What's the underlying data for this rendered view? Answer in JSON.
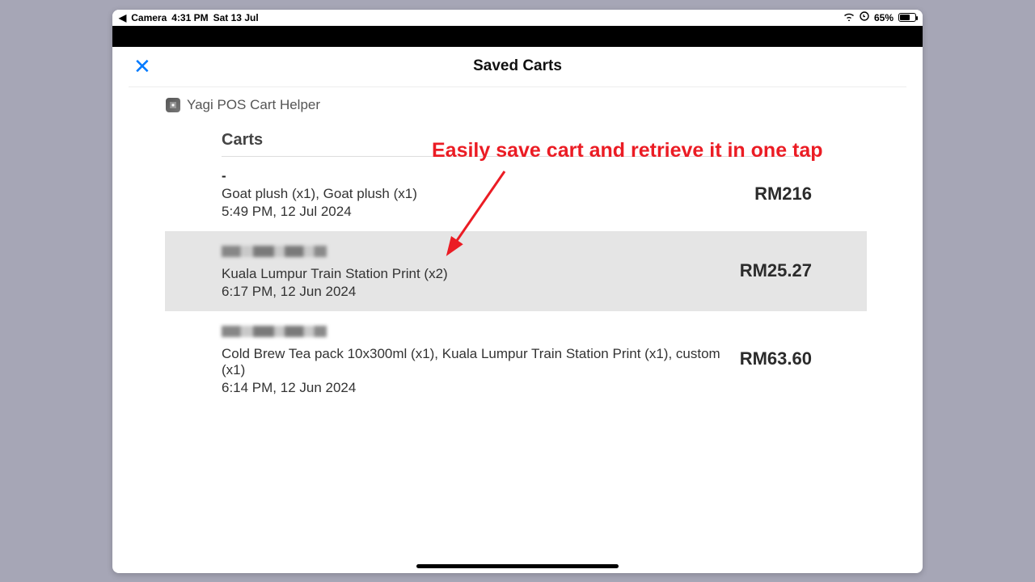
{
  "status": {
    "back_label": "Camera",
    "time": "4:31 PM",
    "date": "Sat 13 Jul",
    "battery_pct": "65%"
  },
  "modal": {
    "title": "Saved Carts",
    "app_name": "Yagi POS Cart Helper",
    "section_heading": "Carts"
  },
  "annotation": {
    "text": "Easily save cart and retrieve it in one tap"
  },
  "carts": [
    {
      "title": "-",
      "description": "Goat plush (x1), Goat plush (x1)",
      "timestamp": "5:49 PM, 12 Jul 2024",
      "price": "RM216",
      "redacted_title": false,
      "highlighted": false
    },
    {
      "title": "",
      "description": "Kuala Lumpur Train Station Print (x2)",
      "timestamp": "6:17 PM, 12 Jun 2024",
      "price": "RM25.27",
      "redacted_title": true,
      "highlighted": true
    },
    {
      "title": "",
      "description": "Cold Brew Tea pack 10x300ml (x1), Kuala Lumpur Train Station Print (x1), custom (x1)",
      "timestamp": "6:14 PM, 12 Jun 2024",
      "price": "RM63.60",
      "redacted_title": true,
      "highlighted": false
    }
  ]
}
